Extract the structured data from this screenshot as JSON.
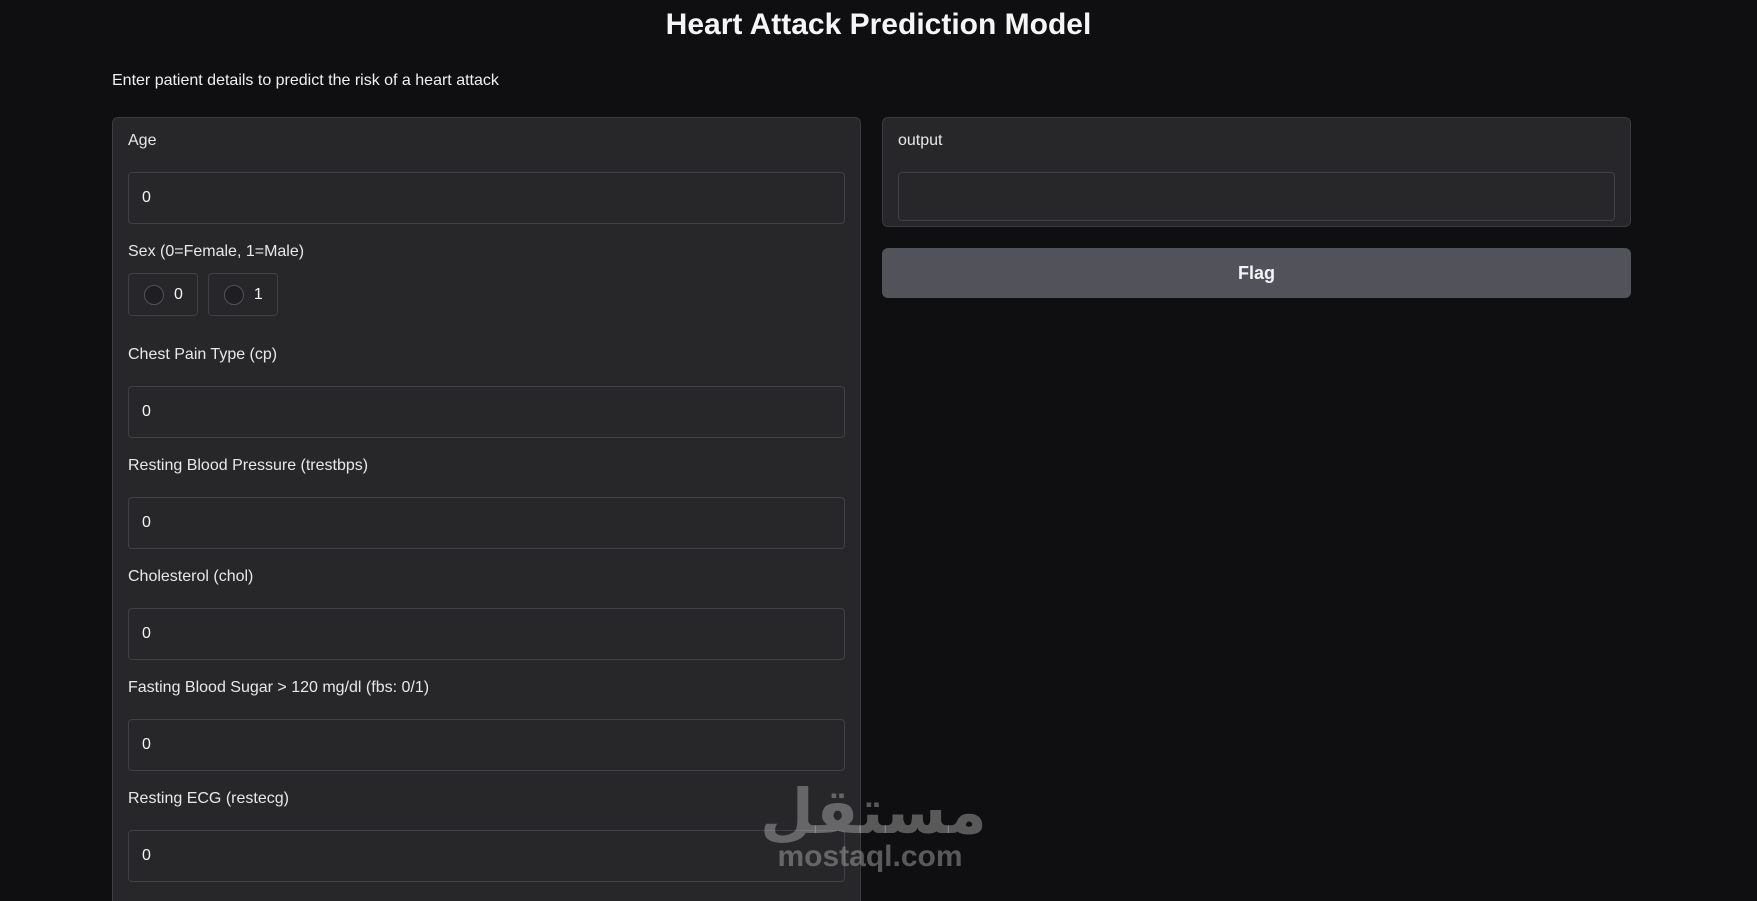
{
  "header": {
    "title": "Heart Attack Prediction Model",
    "description": "Enter patient details to predict the risk of a heart attack"
  },
  "inputs": {
    "age": {
      "label": "Age",
      "value": "0"
    },
    "sex": {
      "label": "Sex (0=Female, 1=Male)",
      "options": [
        "0",
        "1"
      ],
      "selected": null
    },
    "cp": {
      "label": "Chest Pain Type (cp)",
      "value": "0"
    },
    "trestbps": {
      "label": "Resting Blood Pressure (trestbps)",
      "value": "0"
    },
    "chol": {
      "label": "Cholesterol (chol)",
      "value": "0"
    },
    "fbs": {
      "label": "Fasting Blood Sugar > 120 mg/dl (fbs: 0/1)",
      "value": "0"
    },
    "restecg": {
      "label": "Resting ECG (restecg)",
      "value": "0"
    }
  },
  "output": {
    "label": "output",
    "value": ""
  },
  "actions": {
    "flag_label": "Flag"
  },
  "watermark": {
    "arabic": "مستقل",
    "latin": "mostaql.com"
  },
  "colors": {
    "background": "#0f0f11",
    "panel": "#27272a",
    "border": "#404046",
    "button": "#52525b",
    "text": "#f3f4f6"
  }
}
